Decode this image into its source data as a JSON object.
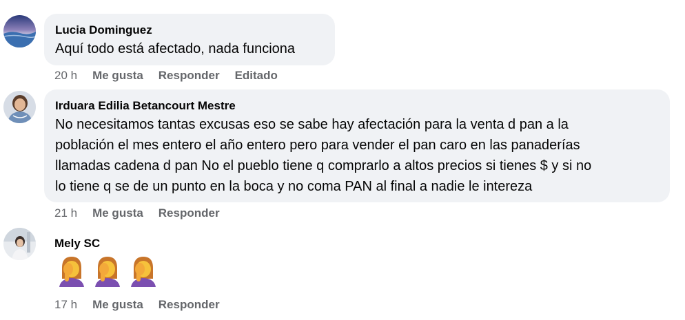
{
  "comments": [
    {
      "author": "Lucia Dominguez",
      "lines": [
        "Aquí todo está afectado, nada funciona"
      ],
      "time": "20 h",
      "like": "Me gusta",
      "reply": "Responder",
      "edited": "Editado"
    },
    {
      "author": "Irduara Edilia Betancourt Mestre",
      "lines": [
        "No necesitamos tantas excusas eso se sabe hay afectación para la venta d pan a la",
        "población el mes entero el año entero pero para vender el pan caro en las panaderías",
        "llamadas cadena d pan No el pueblo tiene q comprarlo a altos precios si tienes $ y si no",
        "lo tiene q se de un punto en la boca y no coma PAN al final a nadie le intereza"
      ],
      "time": "21 h",
      "like": "Me gusta",
      "reply": "Responder"
    },
    {
      "author": "Mely SC",
      "emoji_icon": "woman-facepalming-emoji",
      "emoji_count": 3,
      "time": "17 h",
      "like": "Me gusta",
      "reply": "Responder"
    }
  ],
  "colors": {
    "bubble": "#f0f2f5",
    "meta_text": "#65676b",
    "primary_text": "#050505"
  }
}
